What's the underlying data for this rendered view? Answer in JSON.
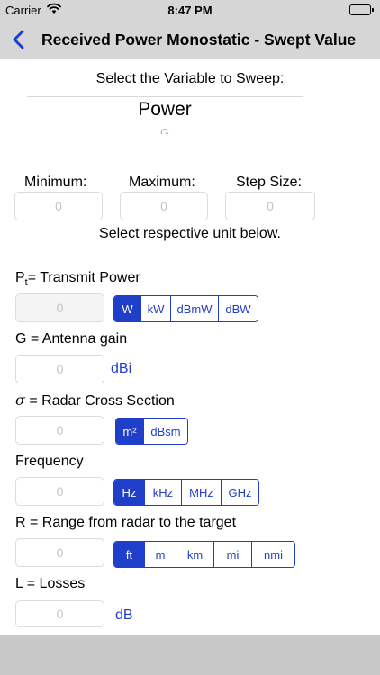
{
  "status": {
    "carrier": "Carrier",
    "time": "8:47 PM"
  },
  "nav": {
    "title": "Received Power Monostatic - Swept Value"
  },
  "sweep": {
    "prompt": "Select the Variable to Sweep:",
    "selected": "Power",
    "next": "G",
    "min_label": "Minimum:",
    "max_label": "Maximum:",
    "step_label": "Step Size:",
    "min_value": "0",
    "max_value": "0",
    "step_value": "0",
    "unit_note": "Select respective unit below."
  },
  "pt": {
    "label_main": "P",
    "label_sub": "t",
    "label_rest": "= Transmit Power",
    "value": "0",
    "units": [
      "W",
      "kW",
      "dBmW",
      "dBW"
    ],
    "selected": 0
  },
  "gain": {
    "label": "G = Antenna gain",
    "value": "0",
    "unit": "dBi"
  },
  "rcs": {
    "label_sym": "σ",
    "label_rest": " = Radar Cross Section",
    "value": "0",
    "units": [
      "m²",
      "dBsm"
    ],
    "selected": 0
  },
  "freq": {
    "label": "Frequency",
    "value": "0",
    "units": [
      "Hz",
      "kHz",
      "MHz",
      "GHz"
    ],
    "selected": 0
  },
  "range": {
    "label": "R = Range from radar to the target",
    "value": "0",
    "units": [
      "ft",
      "m",
      "km",
      "mi",
      "nmi"
    ],
    "selected": 0
  },
  "losses": {
    "label": "L = Losses",
    "value": "0",
    "unit": "dB"
  },
  "colors": {
    "accent": "#1f3ec9",
    "bar": "#d6d6d6"
  }
}
